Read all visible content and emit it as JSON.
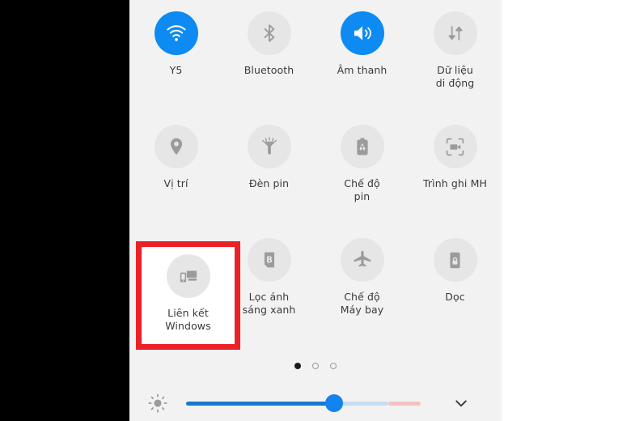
{
  "panel": {
    "background_color": "#f2f2f2",
    "accent_color": "#0d8bf2",
    "highlight_color": "#ec2027",
    "rows": [
      {
        "tiles": [
          {
            "label": "Y5",
            "icon": "wifi-icon",
            "active": true
          },
          {
            "label": "Bluetooth",
            "icon": "bluetooth-icon",
            "active": false
          },
          {
            "label": "Âm thanh",
            "icon": "sound-icon",
            "active": true
          },
          {
            "label": "Dữ liệu\ndi động",
            "icon": "mobile-data-icon",
            "active": false
          }
        ]
      },
      {
        "tiles": [
          {
            "label": "Vị trí",
            "icon": "location-pin-icon",
            "active": false
          },
          {
            "label": "Đèn pin",
            "icon": "flashlight-icon",
            "active": false
          },
          {
            "label": "Chế độ\npin",
            "icon": "battery-saver-icon",
            "active": false
          },
          {
            "label": "Trình ghi MH",
            "icon": "screen-recorder-icon",
            "active": false
          }
        ]
      },
      {
        "tiles": [
          {
            "label": "Liên kết\nWindows",
            "icon": "link-to-windows-icon",
            "active": false,
            "highlighted": true
          },
          {
            "label": "Lọc ánh\nsáng xanh",
            "icon": "blue-light-filter-icon",
            "active": false
          },
          {
            "label": "Chế độ\nMáy bay",
            "icon": "airplane-mode-icon",
            "active": false
          },
          {
            "label": "Dọc",
            "icon": "rotation-lock-icon",
            "active": false
          }
        ]
      }
    ]
  },
  "pager": {
    "total_pages": 3,
    "current_page": 1
  },
  "brightness": {
    "icon": "brightness-sun-icon",
    "value_percent": 62,
    "fill_color": "#1877cf",
    "thumb_color": "#1383f0",
    "mid_color": "#c6dcf3",
    "rest_color": "#f3c3c3"
  },
  "expand": {
    "icon": "chevron-down-icon"
  }
}
